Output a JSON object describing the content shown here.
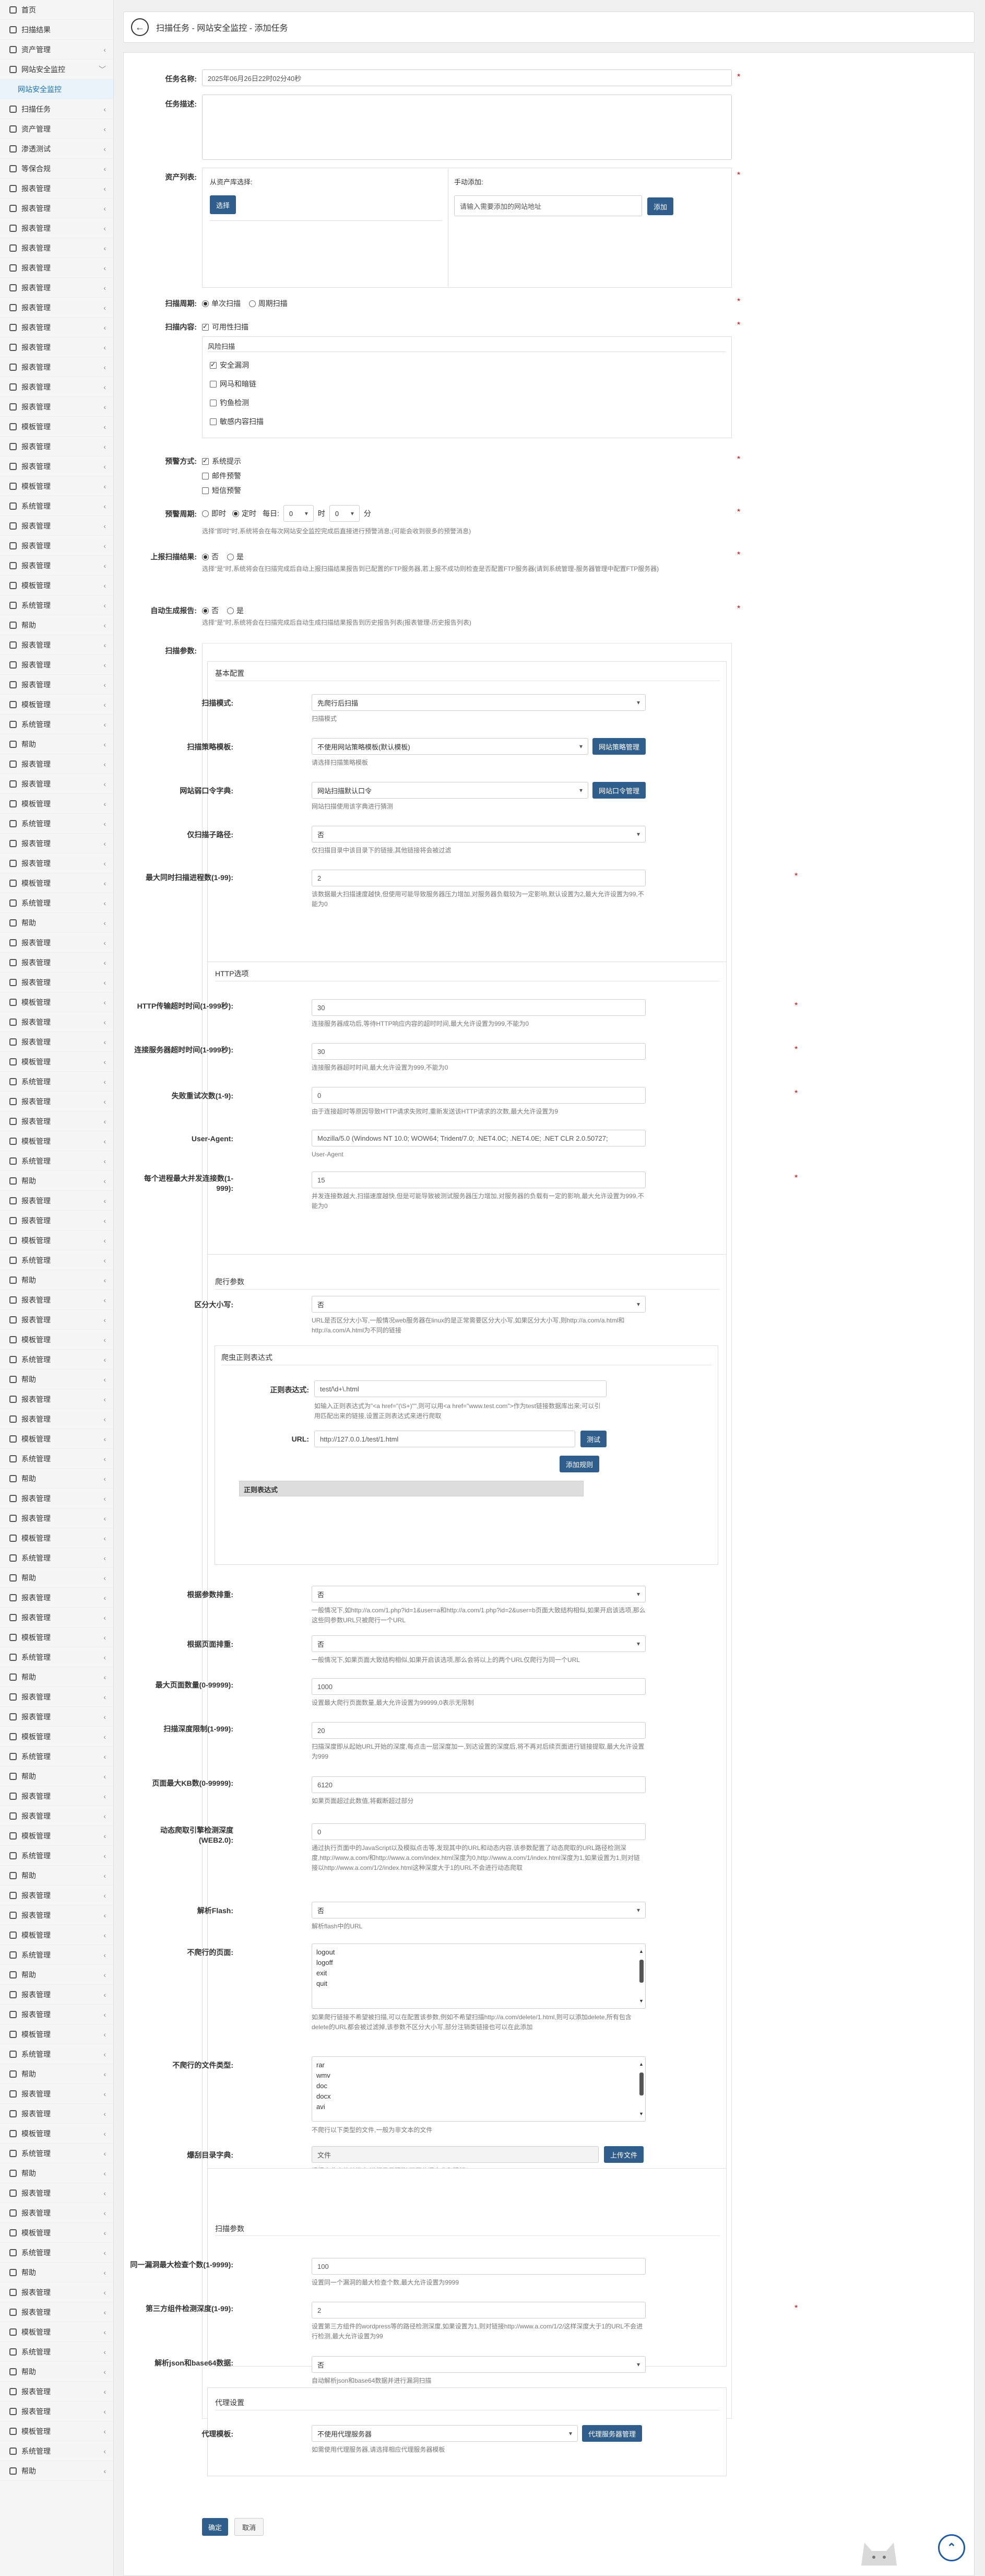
{
  "sidebar": {
    "items": [
      {
        "label": "首页",
        "icon": "home-icon",
        "chevron": false
      },
      {
        "label": "扫描结果",
        "icon": "result-icon",
        "chevron": false
      },
      {
        "label": "资产管理",
        "icon": "asset-icon",
        "chevron": true
      },
      {
        "label": "网站安全监控",
        "icon": "monitor-icon",
        "chevron": true,
        "expanded": true
      },
      {
        "label": "网站安全监控",
        "icon": "",
        "chevron": false,
        "sub": true
      },
      {
        "label": "扫描任务",
        "icon": "task-icon",
        "chevron": true
      },
      {
        "label": "资产管理",
        "icon": "asset-icon",
        "chevron": true
      },
      {
        "label": "渗透测试",
        "icon": "pentest-icon",
        "chevron": true
      },
      {
        "label": "等保合规",
        "icon": "comply-icon",
        "chevron": true
      },
      {
        "label": "报表管理",
        "icon": "report-icon",
        "chevron": true
      },
      {
        "label": "报表管理",
        "icon": "report-icon",
        "chevron": true
      },
      {
        "label": "报表管理",
        "icon": "report-icon",
        "chevron": true
      },
      {
        "label": "报表管理",
        "icon": "report-icon",
        "chevron": true
      },
      {
        "label": "报表管理",
        "icon": "report-icon",
        "chevron": true
      },
      {
        "label": "报表管理",
        "icon": "report-icon",
        "chevron": true
      },
      {
        "label": "报表管理",
        "icon": "report-icon",
        "chevron": true
      },
      {
        "label": "报表管理",
        "icon": "report-icon",
        "chevron": true
      },
      {
        "label": "报表管理",
        "icon": "report-icon",
        "chevron": true
      },
      {
        "label": "报表管理",
        "icon": "report-icon",
        "chevron": true
      },
      {
        "label": "报表管理",
        "icon": "report-icon",
        "chevron": true
      },
      {
        "label": "报表管理",
        "icon": "report-icon",
        "chevron": true
      },
      {
        "label": "模板管理",
        "icon": "template-icon",
        "chevron": true
      },
      {
        "label": "报表管理",
        "icon": "report-icon",
        "chevron": true
      },
      {
        "label": "报表管理",
        "icon": "report-icon",
        "chevron": true
      },
      {
        "label": "模板管理",
        "icon": "template-icon",
        "chevron": true
      },
      {
        "label": "系统管理",
        "icon": "system-icon",
        "chevron": true
      },
      {
        "label": "报表管理",
        "icon": "report-icon",
        "chevron": true
      },
      {
        "label": "报表管理",
        "icon": "report-icon",
        "chevron": true
      },
      {
        "label": "报表管理",
        "icon": "report-icon",
        "chevron": true
      },
      {
        "label": "模板管理",
        "icon": "template-icon",
        "chevron": true
      },
      {
        "label": "系统管理",
        "icon": "system-icon",
        "chevron": true
      },
      {
        "label": "帮助",
        "icon": "help-icon",
        "chevron": true
      },
      {
        "label": "报表管理",
        "icon": "report-icon",
        "chevron": true
      },
      {
        "label": "报表管理",
        "icon": "report-icon",
        "chevron": true
      },
      {
        "label": "报表管理",
        "icon": "report-icon",
        "chevron": true
      },
      {
        "label": "模板管理",
        "icon": "template-icon",
        "chevron": true
      },
      {
        "label": "系统管理",
        "icon": "system-icon",
        "chevron": true
      },
      {
        "label": "帮助",
        "icon": "help-icon",
        "chevron": true
      },
      {
        "label": "报表管理",
        "icon": "report-icon",
        "chevron": true
      },
      {
        "label": "报表管理",
        "icon": "report-icon",
        "chevron": true
      },
      {
        "label": "模板管理",
        "icon": "template-icon",
        "chevron": true
      },
      {
        "label": "系统管理",
        "icon": "system-icon",
        "chevron": true
      },
      {
        "label": "报表管理",
        "icon": "report-icon",
        "chevron": true
      },
      {
        "label": "报表管理",
        "icon": "report-icon",
        "chevron": true
      },
      {
        "label": "模板管理",
        "icon": "template-icon",
        "chevron": true
      },
      {
        "label": "系统管理",
        "icon": "system-icon",
        "chevron": true
      },
      {
        "label": "帮助",
        "icon": "help-icon",
        "chevron": true
      },
      {
        "label": "报表管理",
        "icon": "report-icon",
        "chevron": true
      },
      {
        "label": "报表管理",
        "icon": "report-icon",
        "chevron": true
      },
      {
        "label": "报表管理",
        "icon": "report-icon",
        "chevron": true
      },
      {
        "label": "模板管理",
        "icon": "template-icon",
        "chevron": true
      },
      {
        "label": "报表管理",
        "icon": "report-icon",
        "chevron": true
      },
      {
        "label": "报表管理",
        "icon": "report-icon",
        "chevron": true
      },
      {
        "label": "模板管理",
        "icon": "template-icon",
        "chevron": true
      },
      {
        "label": "系统管理",
        "icon": "system-icon",
        "chevron": true
      },
      {
        "label": "报表管理",
        "icon": "report-icon",
        "chevron": true
      },
      {
        "label": "报表管理",
        "icon": "report-icon",
        "chevron": true
      },
      {
        "label": "模板管理",
        "icon": "template-icon",
        "chevron": true
      },
      {
        "label": "系统管理",
        "icon": "system-icon",
        "chevron": true
      },
      {
        "label": "帮助",
        "icon": "help-icon",
        "chevron": true
      },
      {
        "label": "报表管理",
        "icon": "report-icon",
        "chevron": true
      },
      {
        "label": "报表管理",
        "icon": "report-icon",
        "chevron": true
      },
      {
        "label": "模板管理",
        "icon": "template-icon",
        "chevron": true
      },
      {
        "label": "系统管理",
        "icon": "system-icon",
        "chevron": true
      },
      {
        "label": "帮助",
        "icon": "help-icon",
        "chevron": true
      },
      {
        "label": "报表管理",
        "icon": "report-icon",
        "chevron": true
      },
      {
        "label": "报表管理",
        "icon": "report-icon",
        "chevron": true
      },
      {
        "label": "模板管理",
        "icon": "template-icon",
        "chevron": true
      },
      {
        "label": "系统管理",
        "icon": "system-icon",
        "chevron": true
      },
      {
        "label": "帮助",
        "icon": "help-icon",
        "chevron": true
      },
      {
        "label": "报表管理",
        "icon": "report-icon",
        "chevron": true
      },
      {
        "label": "报表管理",
        "icon": "report-icon",
        "chevron": true
      },
      {
        "label": "模板管理",
        "icon": "template-icon",
        "chevron": true
      },
      {
        "label": "系统管理",
        "icon": "system-icon",
        "chevron": true
      },
      {
        "label": "帮助",
        "icon": "help-icon",
        "chevron": true
      },
      {
        "label": "报表管理",
        "icon": "report-icon",
        "chevron": true
      },
      {
        "label": "报表管理",
        "icon": "report-icon",
        "chevron": true
      },
      {
        "label": "模板管理",
        "icon": "template-icon",
        "chevron": true
      },
      {
        "label": "系统管理",
        "icon": "system-icon",
        "chevron": true
      },
      {
        "label": "帮助",
        "icon": "help-icon",
        "chevron": true
      },
      {
        "label": "报表管理",
        "icon": "report-icon",
        "chevron": true
      },
      {
        "label": "报表管理",
        "icon": "report-icon",
        "chevron": true
      },
      {
        "label": "模板管理",
        "icon": "template-icon",
        "chevron": true
      },
      {
        "label": "系统管理",
        "icon": "system-icon",
        "chevron": true
      },
      {
        "label": "帮助",
        "icon": "help-icon",
        "chevron": true
      },
      {
        "label": "报表管理",
        "icon": "report-icon",
        "chevron": true
      },
      {
        "label": "报表管理",
        "icon": "report-icon",
        "chevron": true
      },
      {
        "label": "模板管理",
        "icon": "template-icon",
        "chevron": true
      },
      {
        "label": "系统管理",
        "icon": "system-icon",
        "chevron": true
      },
      {
        "label": "帮助",
        "icon": "help-icon",
        "chevron": true
      },
      {
        "label": "报表管理",
        "icon": "report-icon",
        "chevron": true
      },
      {
        "label": "报表管理",
        "icon": "report-icon",
        "chevron": true
      },
      {
        "label": "模板管理",
        "icon": "template-icon",
        "chevron": true
      },
      {
        "label": "系统管理",
        "icon": "system-icon",
        "chevron": true
      },
      {
        "label": "帮助",
        "icon": "help-icon",
        "chevron": true
      },
      {
        "label": "报表管理",
        "icon": "report-icon",
        "chevron": true
      },
      {
        "label": "报表管理",
        "icon": "report-icon",
        "chevron": true
      },
      {
        "label": "模板管理",
        "icon": "template-icon",
        "chevron": true
      },
      {
        "label": "系统管理",
        "icon": "system-icon",
        "chevron": true
      },
      {
        "label": "帮助",
        "icon": "help-icon",
        "chevron": true
      },
      {
        "label": "报表管理",
        "icon": "report-icon",
        "chevron": true
      },
      {
        "label": "报表管理",
        "icon": "report-icon",
        "chevron": true
      },
      {
        "label": "模板管理",
        "icon": "template-icon",
        "chevron": true
      },
      {
        "label": "系统管理",
        "icon": "system-icon",
        "chevron": true
      },
      {
        "label": "帮助",
        "icon": "help-icon",
        "chevron": true
      },
      {
        "label": "报表管理",
        "icon": "report-icon",
        "chevron": true
      },
      {
        "label": "报表管理",
        "icon": "report-icon",
        "chevron": true
      },
      {
        "label": "模板管理",
        "icon": "template-icon",
        "chevron": true
      },
      {
        "label": "系统管理",
        "icon": "system-icon",
        "chevron": true
      },
      {
        "label": "帮助",
        "icon": "help-icon",
        "chevron": true
      },
      {
        "label": "报表管理",
        "icon": "report-icon",
        "chevron": true
      },
      {
        "label": "报表管理",
        "icon": "report-icon",
        "chevron": true
      },
      {
        "label": "模板管理",
        "icon": "template-icon",
        "chevron": true
      },
      {
        "label": "系统管理",
        "icon": "system-icon",
        "chevron": true
      },
      {
        "label": "帮助",
        "icon": "help-icon",
        "chevron": true
      },
      {
        "label": "报表管理",
        "icon": "report-icon",
        "chevron": true
      },
      {
        "label": "报表管理",
        "icon": "report-icon",
        "chevron": true
      },
      {
        "label": "模板管理",
        "icon": "template-icon",
        "chevron": true
      },
      {
        "label": "系统管理",
        "icon": "system-icon",
        "chevron": true
      },
      {
        "label": "帮助",
        "icon": "help-icon",
        "chevron": true
      },
      {
        "label": "报表管理",
        "icon": "report-icon",
        "chevron": true
      },
      {
        "label": "报表管理",
        "icon": "report-icon",
        "chevron": true
      },
      {
        "label": "模板管理",
        "icon": "template-icon",
        "chevron": true
      },
      {
        "label": "系统管理",
        "icon": "system-icon",
        "chevron": true
      },
      {
        "label": "帮助",
        "icon": "help-icon",
        "chevron": true
      }
    ]
  },
  "breadcrumb": "扫描任务 - 网站安全监控 - 添加任务",
  "form": {
    "task_name": {
      "label": "任务名称:",
      "value": "2025年06月26日22时02分40秒"
    },
    "task_desc": {
      "label": "任务描述:"
    },
    "asset_list": {
      "label": "资产列表:",
      "from_assets": "从资产库选择:",
      "select_btn": "选择",
      "manual_add": "手动添加:",
      "manual_placeholder": "请输入需要添加的网站地址",
      "add_btn": "添加"
    },
    "scan_cycle": {
      "label": "扫描周期:",
      "options": [
        "单次扫描",
        "周期扫描"
      ],
      "selected": 0
    },
    "scan_content": {
      "label": "扫描内容:",
      "availability": "可用性扫描",
      "risk_scan": "风险扫描",
      "items": [
        "安全漏洞",
        "网马和暗链",
        "钓鱼检测",
        "敏感内容扫描"
      ],
      "checked": [
        true,
        false,
        false,
        false
      ]
    },
    "alert_method": {
      "label": "预警方式:",
      "items": [
        "系统提示",
        "邮件预警",
        "短信预警"
      ],
      "checked": [
        true,
        false,
        false
      ]
    },
    "alert_cycle": {
      "label": "预警周期:",
      "options": [
        "即时",
        "定时"
      ],
      "selected": 1,
      "daily": "每日:",
      "hour": "0",
      "hour_unit": "时",
      "minute": "0",
      "minute_unit": "分",
      "help": "选择\"即时\"时,系统将会在每次网站安全监控完成后直接进行预警消息;(可能会收到很多的预警消息)"
    },
    "upload_result": {
      "label": "上报扫描结果:",
      "options": [
        "否",
        "是"
      ],
      "selected": 0,
      "help": "选择\"是\"时,系统将会在扫描完成后自动上报扫描结果报告到已配置的FTP服务器,若上报不成功则检查是否配置FTP服务器(请到系统管理-服务器管理中配置FTP服务器)"
    },
    "auto_report": {
      "label": "自动生成报告:",
      "options": [
        "否",
        "是"
      ],
      "selected": 0,
      "help": "选择\"是\"时,系统将会在扫描完成后自动生成扫描结果报告到历史报告列表(报表管理-历史报告列表)"
    },
    "scan_params": {
      "label": "扫描参数:"
    }
  },
  "basic": {
    "title": "基本配置",
    "scan_mode": {
      "label": "扫描模式:",
      "value": "先爬行后扫描",
      "help": "扫描模式"
    },
    "policy": {
      "label": "扫描策略模板:",
      "value": "不使用网站策略模板(默认模板)",
      "btn": "网站策略管理",
      "help": "请选择扫描策略模板"
    },
    "dict": {
      "label": "网站弱口令字典:",
      "value": "网站扫描默认口令",
      "btn": "网站口令管理",
      "help": "网站扫描使用该字典进行猜测"
    },
    "subpath": {
      "label": "仅扫描子路径:",
      "value": "否",
      "help": "仅扫描目录中该目录下的链接,其他链接将会被过滤"
    },
    "max_proc": {
      "label": "最大同时扫描进程数(1-99):",
      "value": "2",
      "help": "该数据最大扫描速度越快,但使用可能导致服务器压力增加,对服务器负载较为一定影响,默认设置为2,最大允许设置为99,不能为0"
    }
  },
  "http": {
    "title": "HTTP选项",
    "timeout": {
      "label": "HTTP传输超时时间(1-999秒):",
      "value": "30",
      "help": "连接服务器成功后,等待HTTP响应内容的超时时间,最大允许设置为999,不能为0"
    },
    "conn_timeout": {
      "label": "连接服务器超时时间(1-999秒):",
      "value": "30",
      "help": "连接服务器超时时间,最大允许设置为999,不能为0"
    },
    "retry": {
      "label": "失败重试次数(1-9):",
      "value": "0",
      "help": "由于连接超时等原因导致HTTP请求失败时,重新发送该HTTP请求的次数,最大允许设置为9"
    },
    "ua": {
      "label": "User-Agent:",
      "value": "Mozilla/5.0 (Windows NT 10.0; WOW64; Trident/7.0; .NET4.0C; .NET4.0E; .NET CLR 2.0.50727;",
      "help": "User-Agent"
    },
    "max_conn": {
      "label": "每个进程最大并发连接数(1-999):",
      "value": "15",
      "help": "并发连接数越大,扫描速度越快,但是可能导致被测试服务器压力增加,对服务器的负载有一定的影响,最大允许设置为999,不能为0"
    }
  },
  "crawl": {
    "title": "爬行参数",
    "case": {
      "label": "区分大小写:",
      "value": "否",
      "help": "URL是否区分大小写,一般情况web服务器在linux的是正常需要区分大小写,如果区分大小写,则http://a.com/a.html和http://a.com/A.html为不同的链接"
    },
    "regex_group": {
      "title": "爬虫正则表达式",
      "regex_label": "正则表达式:",
      "regex_value": "test/\\d+\\.html",
      "regex_help": "如输入正则表达式为\"<a href=\"(\\S+)\"\",则可以用<a href=\"www.test.com\">作为test链接数据库出来;可以引用匹配出来的链接,设置正则表达式来进行爬取",
      "url_label": "URL:",
      "url_value": "http://127.0.0.1/test/1.html",
      "test_btn": "测试",
      "add_btn": "添加规则",
      "table_header": "正则表达式"
    },
    "param_filter": {
      "label": "根据参数排重:",
      "value": "否",
      "help": "一般情况下,如http://a.com/1.php?id=1&user=a和http://a.com/1.php?id=2&user=b页面大致结构相似,如果开启该选项,那么这些同参数URL只被爬行一个URL"
    },
    "page_filter": {
      "label": "根据页面排重:",
      "value": "否",
      "help": "一般情况下,如果页面大致结构相似,如果开启该选项,那么会将以上的两个URL仅爬行为同一个URL"
    },
    "max_pages": {
      "label": "最大页面数量(0-99999):",
      "value": "1000",
      "help": "设置最大爬行页面数量,最大允许设置为99999,0表示无限制"
    },
    "depth": {
      "label": "扫描深度限制(1-999):",
      "value": "20",
      "help": "扫描深度即从起始URL开始的深度,每点击一层深度加一,到达设置的深度后,将不再对后续页面进行链接提取,最大允许设置为999"
    },
    "max_kb": {
      "label": "页面最大KB数(0-99999):",
      "value": "6120",
      "help": "如果页面超过此数值,将截断超过部分"
    },
    "dynamic": {
      "label": "动态爬取引擎检测深度(WEB2.0):",
      "value": "0",
      "help": "通过执行页面中的JavaScript以及模拟点击等,发现其中的URL和动态内容,该参数配置了动态爬取的URL路径检测深度,http://www.a.com/和http://www.a.com/index.html深度为0,http://www.a.com/1/index.html深度为1,如果设置为1,则对链接以http://www.a.com/1/2/index.html这种深度大于1的URL不会进行动态爬取"
    },
    "flash": {
      "label": "解析Flash:",
      "value": "否",
      "help": "解析flash中的URL"
    },
    "no_crawl_pages": {
      "label": "不爬行的页面:",
      "items": [
        "logout",
        "logoff",
        "exit",
        "quit"
      ],
      "help": "如果爬行链接不希望被扫描,可以在配置该参数,例如不希望扫描http://a.com/delete/1.html,则可以添加delete,所有包含delete的URL都会被过滤掉,该参数不区分大小写,部分注销类链接也可以在此添加"
    },
    "no_crawl_types": {
      "label": "不爬行的文件类型:",
      "items": [
        "rar",
        "wmv",
        "doc",
        "docx",
        "avi"
      ],
      "help": "不爬行以下类型的文件,一般为非文本的文件"
    },
    "cookie": {
      "label": "爆刮目录字典:",
      "placeholder": "文件",
      "btn": "上传文件",
      "help": "根据字典中的关键字,进行目录猜测,不区分爆字典和猜解"
    }
  },
  "scan": {
    "title": "扫描参数",
    "same_vuln": {
      "label": "同一漏洞最大检查个数(1-9999):",
      "value": "100",
      "help": "设置同一个漏洞的最大检查个数,最大允许设置为9999"
    },
    "third_depth": {
      "label": "第三方组件检测深度(1-99):",
      "value": "2",
      "help": "设置第三方组件的wordpress等的路径检测深度,如果设置为1,则对链接http://www.a.com/1/2/这样深度大于1的URL不会进行检测,最大允许设置为99"
    },
    "json": {
      "label": "解析json和base64数据:",
      "value": "否",
      "help": "自动解析json和base64数据并进行漏洞扫描"
    }
  },
  "proxy": {
    "title": "代理设置",
    "tpl": {
      "label": "代理模板:",
      "value": "不使用代理服务器",
      "btn": "代理服务器管理",
      "help": "如需使用代理服务器,请选择相应代理服务器模板"
    }
  },
  "footer": {
    "confirm": "确定",
    "cancel": "取消"
  },
  "colors": {
    "primary": "#2f5d8c",
    "required": "#cc0000"
  }
}
